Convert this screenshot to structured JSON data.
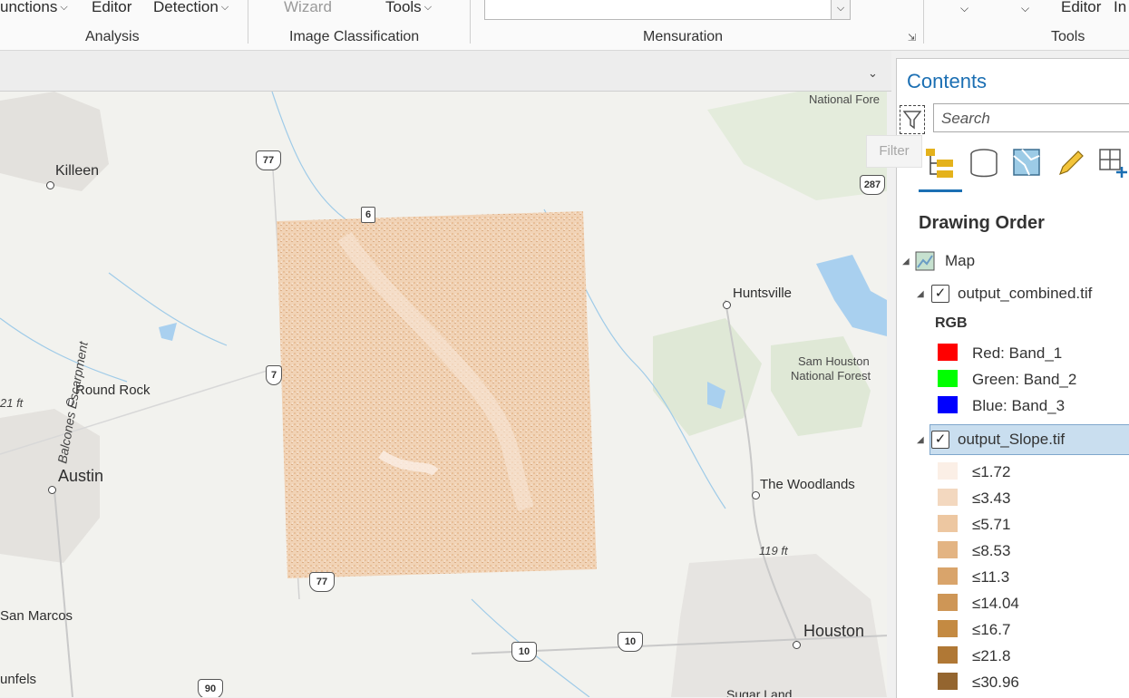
{
  "ribbon": {
    "analysis": {
      "items": [
        "unctions",
        "Editor",
        "Detection"
      ],
      "group_label": "Analysis"
    },
    "image_classification": {
      "items": [
        "Wizard",
        "Tools"
      ],
      "group_label": "Image Classification"
    },
    "mensuration": {
      "group_label": "Mensuration"
    },
    "tools": {
      "items": [
        "Editor",
        "In"
      ],
      "group_label": "Tools"
    }
  },
  "map": {
    "places": [
      "Killeen",
      "Huntsville",
      "Round Rock",
      "Austin",
      "The Woodlands",
      "San Marcos",
      "Houston",
      "unfels",
      "Sugar Land",
      "National Fore",
      "Sam Houston",
      "National Forest"
    ],
    "escarpment": "Balcones Escarpment",
    "elevations": [
      "21 ft",
      "119 ft"
    ],
    "highway_shields": [
      "77",
      "6",
      "7",
      "77",
      "10",
      "10",
      "90",
      "287"
    ]
  },
  "contents": {
    "title": "Contents",
    "search_placeholder": "Search",
    "filter_tooltip": "Filter",
    "section": "Drawing Order",
    "map_label": "Map",
    "layer1": {
      "name": "output_combined.tif",
      "renderer": "RGB",
      "bands": [
        {
          "label": "Red:   Band_1",
          "color": "#ff0000"
        },
        {
          "label": "Green: Band_2",
          "color": "#00ff00"
        },
        {
          "label": "Blue:  Band_3",
          "color": "#0000ff"
        }
      ]
    },
    "layer2": {
      "name": "output_Slope.tif",
      "classes": [
        {
          "label": "≤1.72",
          "color": "#fbefe6"
        },
        {
          "label": "≤3.43",
          "color": "#f3d8bf"
        },
        {
          "label": "≤5.71",
          "color": "#edc7a1"
        },
        {
          "label": "≤8.53",
          "color": "#e3b483"
        },
        {
          "label": "≤11.3",
          "color": "#d9a46b"
        },
        {
          "label": "≤14.04",
          "color": "#ce9656"
        },
        {
          "label": "≤16.7",
          "color": "#c48a42"
        },
        {
          "label": "≤21.8",
          "color": "#b07835"
        },
        {
          "label": "≤30.96",
          "color": "#94652f"
        }
      ]
    }
  }
}
